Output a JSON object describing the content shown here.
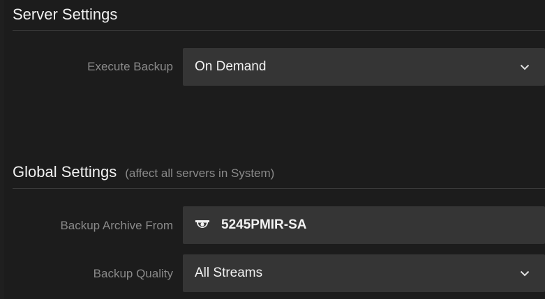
{
  "server_settings": {
    "title": "Server Settings",
    "execute_backup": {
      "label": "Execute Backup",
      "value": "On Demand",
      "icon": "chevron-down-icon"
    }
  },
  "global_settings": {
    "title": "Global Settings",
    "subtitle": "(affect all servers in System)",
    "backup_archive_from": {
      "label": "Backup Archive From",
      "value": "5245PMIR-SA",
      "icon": "camera-icon"
    },
    "backup_quality": {
      "label": "Backup Quality",
      "value": "All Streams",
      "icon": "chevron-down-icon"
    }
  },
  "colors": {
    "background": "#1c1c1c",
    "field_background": "#353535",
    "label_text": "#8a8a8a",
    "value_text": "#f2f2f2",
    "divider": "#3a3a3a"
  }
}
